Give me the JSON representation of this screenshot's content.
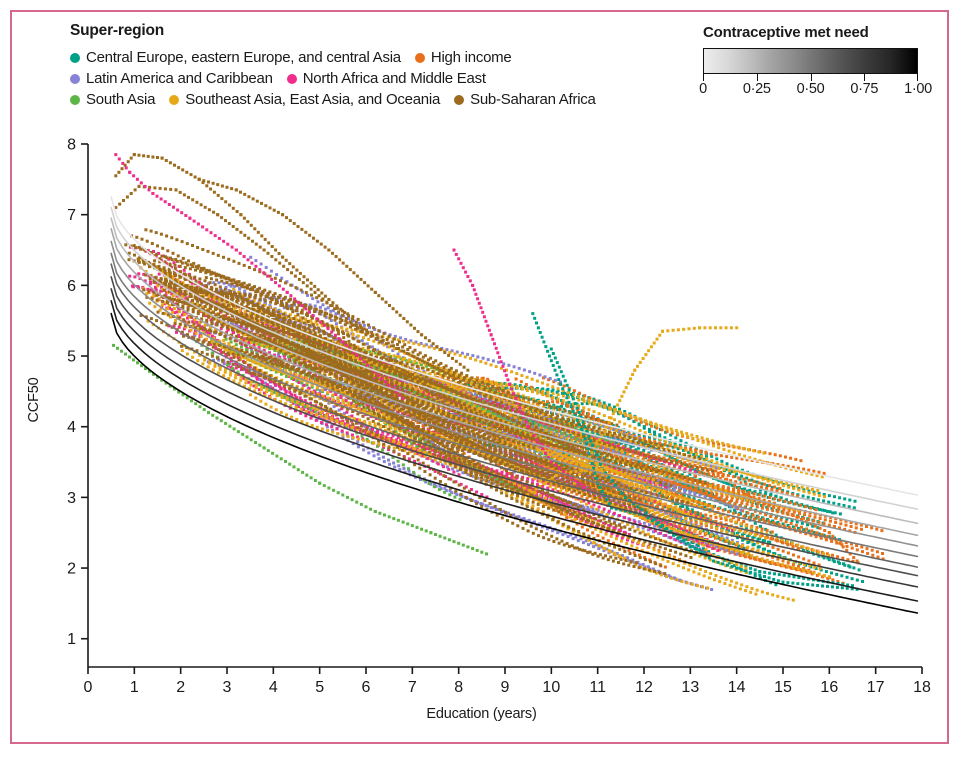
{
  "legend": {
    "title": "Super-region",
    "entries": [
      {
        "label": "Central Europe, eastern Europe, and central Asia",
        "color": "#00a087"
      },
      {
        "label": "High income",
        "color": "#e8701a"
      },
      {
        "label": "Latin America and Caribbean",
        "color": "#8782d6"
      },
      {
        "label": "North Africa and Middle East",
        "color": "#ee2d8c"
      },
      {
        "label": "South Asia",
        "color": "#5cb646"
      },
      {
        "label": "Southeast Asia, East Asia, and Oceania",
        "color": "#e8a918"
      },
      {
        "label": "Sub-Saharan Africa",
        "color": "#9c6b1e"
      }
    ],
    "rows": [
      [
        0,
        1
      ],
      [
        2,
        3
      ],
      [
        4,
        5,
        6
      ]
    ]
  },
  "colorbar": {
    "title": "Contraceptive met need",
    "ticks": [
      "0",
      "0·25",
      "0·50",
      "0·75",
      "1·00"
    ],
    "tick_values": [
      0,
      0.25,
      0.5,
      0.75,
      1.0
    ],
    "min": 0,
    "max": 1,
    "low_color": "#ededed",
    "high_color": "#000000"
  },
  "chart_data": {
    "type": "scatter",
    "title": "",
    "xlabel": "Education (years)",
    "ylabel": "CCF50",
    "xlim": [
      0,
      18
    ],
    "ylim": [
      0.6,
      8
    ],
    "xticks": [
      0,
      1,
      2,
      3,
      4,
      5,
      6,
      7,
      8,
      9,
      10,
      11,
      12,
      13,
      14,
      15,
      16,
      17,
      18
    ],
    "yticks": [
      1,
      2,
      3,
      4,
      5,
      6,
      7,
      8
    ],
    "grid": false,
    "legend_position": "top-left",
    "description": "Country-year trajectories of completed cohort fertility at age 50 (CCF50) against mean years of education, coloured by GBD super-region, overlaid with fitted curves shaded by contraceptive met need.",
    "fitted_curves": {
      "note": "Eleven fitted curves, shaded light grey (met need 0) to black (met need 1). Each curve declines from a high CCF50 at low education to a flat asymptote at high education.",
      "met_need_levels": [
        0.0,
        0.1,
        0.2,
        0.3,
        0.4,
        0.5,
        0.6,
        0.7,
        0.8,
        0.9,
        1.0
      ],
      "colors": [
        "#e6e6e6",
        "#d2d2d2",
        "#bcbcbc",
        "#a6a6a6",
        "#909090",
        "#7a7a7a",
        "#646464",
        "#4e4e4e",
        "#383838",
        "#1c1c1c",
        "#000000"
      ],
      "start_ccf50": [
        7.25,
        7.1,
        6.95,
        6.8,
        6.62,
        6.45,
        6.3,
        6.12,
        5.95,
        5.78,
        5.6
      ],
      "end_ccf50": [
        3.02,
        2.82,
        2.62,
        2.45,
        2.3,
        2.15,
        2.0,
        1.88,
        1.72,
        1.52,
        1.35
      ],
      "x_start": 0.5,
      "x_end": 18
    },
    "series": [
      {
        "name": "Central Europe, eastern Europe, and central Asia",
        "color": "#00a087",
        "x_range": [
          7.5,
          16.8
        ],
        "y_range": [
          1.4,
          5.6
        ],
        "n_points": 900
      },
      {
        "name": "High income",
        "color": "#e8701a",
        "x_range": [
          5.0,
          17.2
        ],
        "y_range": [
          1.3,
          4.6
        ],
        "n_points": 1400
      },
      {
        "name": "Latin America and Caribbean",
        "color": "#8782d6",
        "x_range": [
          2.0,
          14.5
        ],
        "y_range": [
          1.6,
          6.3
        ],
        "n_points": 1100
      },
      {
        "name": "North Africa and Middle East",
        "color": "#ee2d8c",
        "x_range": [
          0.6,
          14.0
        ],
        "y_range": [
          1.7,
          7.9
        ],
        "n_points": 900
      },
      {
        "name": "South Asia",
        "color": "#5cb646",
        "x_range": [
          0.5,
          12.0
        ],
        "y_range": [
          1.5,
          5.15
        ],
        "n_points": 500
      },
      {
        "name": "Southeast Asia, East Asia, and Oceania",
        "color": "#e8a918",
        "x_range": [
          0.8,
          16.5
        ],
        "y_range": [
          1.3,
          7.0
        ],
        "n_points": 1300
      },
      {
        "name": "Sub-Saharan Africa",
        "color": "#9c6b1e",
        "x_range": [
          0.5,
          13.5
        ],
        "y_range": [
          2.0,
          7.9
        ],
        "n_points": 2200
      }
    ]
  }
}
